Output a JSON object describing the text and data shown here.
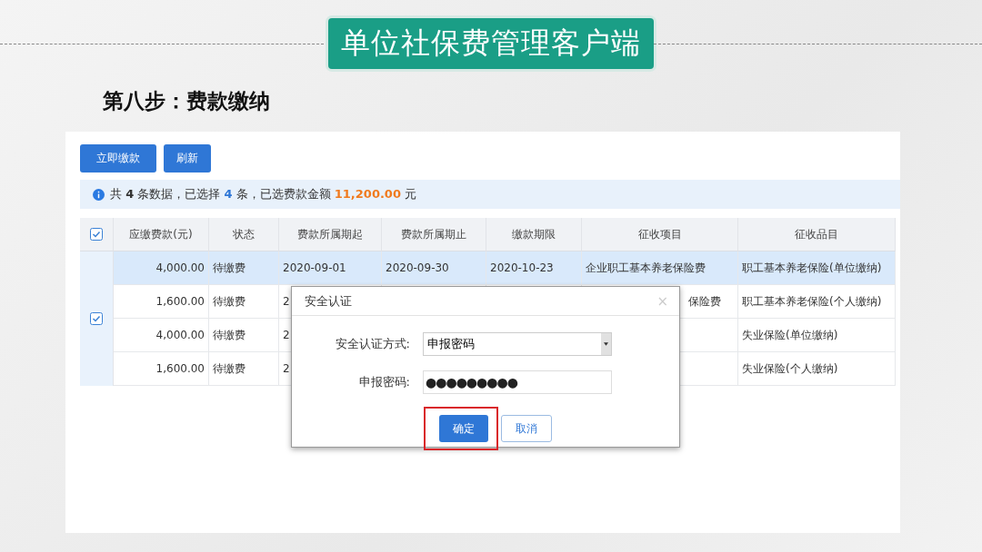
{
  "slide": {
    "banner": "单位社保费管理客户端",
    "step_title": "第八步：费款缴纳"
  },
  "toolbar": {
    "buttons": [
      "立即缴款",
      "刷新"
    ]
  },
  "info_bar": {
    "segments": [
      {
        "kind": "plain",
        "text": "共 "
      },
      {
        "kind": "count",
        "text": "4"
      },
      {
        "kind": "plain",
        "text": " 条数据，已选择 "
      },
      {
        "kind": "selected",
        "text": "4"
      },
      {
        "kind": "plain",
        "text": " 条，已选费款金额 "
      },
      {
        "kind": "amount",
        "text": "11,200.00"
      },
      {
        "kind": "plain",
        "text": " 元"
      }
    ]
  },
  "table": {
    "all_checked": true,
    "group_checked": true,
    "columns": [
      "应缴费款(元)",
      "状态",
      "费款所属期起",
      "费款所属期止",
      "缴款期限",
      "征收项目",
      "征收品目"
    ],
    "rows": [
      {
        "kind": "full",
        "highlighted": true,
        "amount": "4,000.00",
        "status": "待缴费",
        "start": "2020-09-01",
        "end": "2020-09-30",
        "deadline": "2020-10-23",
        "item": "企业职工基本养老保险费",
        "category": "职工基本养老保险(单位缴纳)"
      },
      {
        "kind": "covered",
        "highlighted": false,
        "amount": "1,600.00",
        "status": "待缴费",
        "start": "2",
        "item": "保险费",
        "category": "职工基本养老保险(个人缴纳)"
      },
      {
        "kind": "covered",
        "highlighted": false,
        "amount": "4,000.00",
        "status": "待缴费",
        "start": "2",
        "category": "失业保险(单位缴纳)"
      },
      {
        "kind": "covered",
        "highlighted": false,
        "amount": "1,600.00",
        "status": "待缴费",
        "start": "2",
        "category": "失业保险(个人缴纳)"
      }
    ]
  },
  "dialog": {
    "title": "安全认证",
    "close": "×",
    "fields": [
      {
        "kind": "select",
        "label": "安全认证方式:",
        "value": "申报密码"
      },
      {
        "kind": "password",
        "label": "申报密码:",
        "value": "●●●●●●●●●"
      }
    ],
    "buttons": [
      {
        "kind": "primary",
        "label": "确定",
        "highlighted": true
      },
      {
        "kind": "secondary",
        "label": "取消",
        "highlighted": false
      }
    ]
  }
}
